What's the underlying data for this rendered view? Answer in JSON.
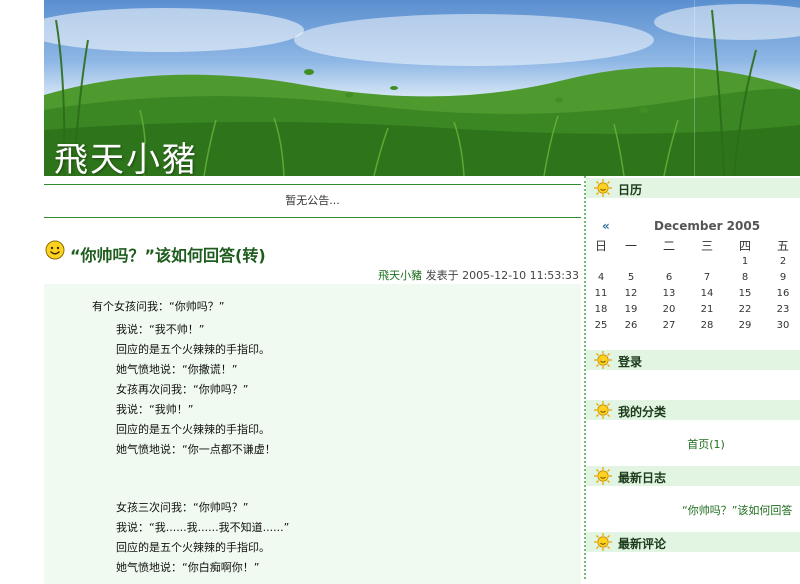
{
  "site": {
    "title": "飛天小豬"
  },
  "announcement": "暂无公告...",
  "post": {
    "title": "“你帅吗？”该如何回答(转)",
    "author": "飛天小豬",
    "posted_label": "发表于",
    "datetime": "2005-12-10 11:53:33",
    "lines": [
      "有个女孩问我：“你帅吗？”",
      "我说：“我不帅！”",
      "回应的是五个火辣辣的手指印。",
      "她气愤地说：“你撒谎！”",
      "女孩再次问我：“你帅吗？”",
      "我说：“我帅！”",
      "回应的是五个火辣辣的手指印。",
      "她气愤地说：“你一点都不谦虚！",
      "女孩三次问我：“你帅吗？”",
      "我说：“我......我......我不知道......”",
      "回应的是五个火辣辣的手指印。",
      "她气愤地说：“你白痴啊你！”"
    ]
  },
  "sidebar": {
    "calendar": {
      "heading": "日历",
      "prev": "«",
      "month": "December 2005",
      "weekdays": [
        "日",
        "一",
        "二",
        "三",
        "四",
        "五"
      ],
      "weeks": [
        [
          "",
          "",
          "",
          "",
          "1",
          "2"
        ],
        [
          "4",
          "5",
          "6",
          "7",
          "8",
          "9"
        ],
        [
          "11",
          "12",
          "13",
          "14",
          "15",
          "16"
        ],
        [
          "18",
          "19",
          "20",
          "21",
          "22",
          "23"
        ],
        [
          "25",
          "26",
          "27",
          "28",
          "29",
          "30"
        ]
      ]
    },
    "login": {
      "heading": "登录"
    },
    "categories": {
      "heading": "我的分类",
      "items": [
        "首页(1)"
      ]
    },
    "recent_posts": {
      "heading": "最新日志",
      "items": [
        "“你帅吗？”该如何回答"
      ]
    },
    "recent_comments": {
      "heading": "最新评论"
    }
  },
  "colors": {
    "accent": "#2e8b2e",
    "title_green": "#1e5c1e",
    "sidebar_head_bg": "#e2f4e2",
    "post_bg": "#f1faf1"
  }
}
